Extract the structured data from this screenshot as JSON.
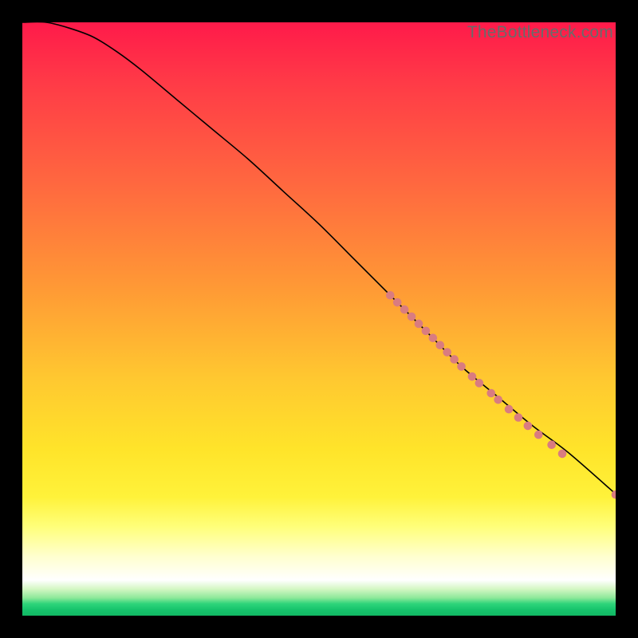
{
  "watermark": "TheBottleneck.com",
  "chart_data": {
    "type": "line",
    "title": "",
    "xlabel": "",
    "ylabel": "",
    "xlim": [
      0,
      100
    ],
    "ylim": [
      0,
      100
    ],
    "grid": false,
    "legend": false,
    "curve": {
      "name": "main-curve",
      "color": "#000000",
      "x": [
        0,
        4,
        8,
        12,
        16,
        20,
        26,
        32,
        38,
        44,
        50,
        56,
        62,
        68,
        74,
        80,
        86,
        92,
        100
      ],
      "y": [
        100,
        100,
        99,
        97.5,
        95,
        92,
        87,
        82,
        77,
        71.5,
        66,
        60,
        54,
        48,
        42,
        37,
        32,
        27.5,
        20.5
      ]
    },
    "highlight_dots": {
      "name": "dense-markers",
      "color": "#d97c80",
      "radius": 5.3,
      "points": [
        {
          "x": 62.0,
          "y": 54.0
        },
        {
          "x": 63.2,
          "y": 52.8
        },
        {
          "x": 64.4,
          "y": 51.6
        },
        {
          "x": 65.6,
          "y": 50.4
        },
        {
          "x": 66.8,
          "y": 49.2
        },
        {
          "x": 68.0,
          "y": 48.0
        },
        {
          "x": 69.2,
          "y": 46.8
        },
        {
          "x": 70.4,
          "y": 45.6
        },
        {
          "x": 71.6,
          "y": 44.4
        },
        {
          "x": 72.8,
          "y": 43.2
        },
        {
          "x": 74.0,
          "y": 42.0
        },
        {
          "x": 75.8,
          "y": 40.3
        },
        {
          "x": 77.0,
          "y": 39.2
        },
        {
          "x": 79.0,
          "y": 37.5
        },
        {
          "x": 80.2,
          "y": 36.4
        },
        {
          "x": 82.0,
          "y": 34.8
        },
        {
          "x": 83.6,
          "y": 33.4
        },
        {
          "x": 85.2,
          "y": 32.0
        },
        {
          "x": 87.0,
          "y": 30.5
        },
        {
          "x": 89.2,
          "y": 28.8
        },
        {
          "x": 91.0,
          "y": 27.3
        }
      ]
    },
    "isolated_dot": {
      "name": "end-marker",
      "color": "#d97c80",
      "radius": 5.3,
      "x": 100,
      "y": 20.4
    },
    "gradient_bands": [
      {
        "label": "red",
        "y_from": 100,
        "y_to": 55,
        "color_top": "#ff1a4a",
        "color_bottom": "#ff9a35"
      },
      {
        "label": "orange",
        "y_from": 55,
        "y_to": 28,
        "color_top": "#ff9a35",
        "color_bottom": "#ffe42a"
      },
      {
        "label": "yellow",
        "y_from": 28,
        "y_to": 10,
        "color_top": "#ffe42a",
        "color_bottom": "#ffffce"
      },
      {
        "label": "white",
        "y_from": 10,
        "y_to": 5,
        "color_top": "#ffffce",
        "color_bottom": "#ffffff"
      },
      {
        "label": "green",
        "y_from": 5,
        "y_to": 0,
        "color_top": "#8de89a",
        "color_bottom": "#12b864"
      }
    ]
  }
}
